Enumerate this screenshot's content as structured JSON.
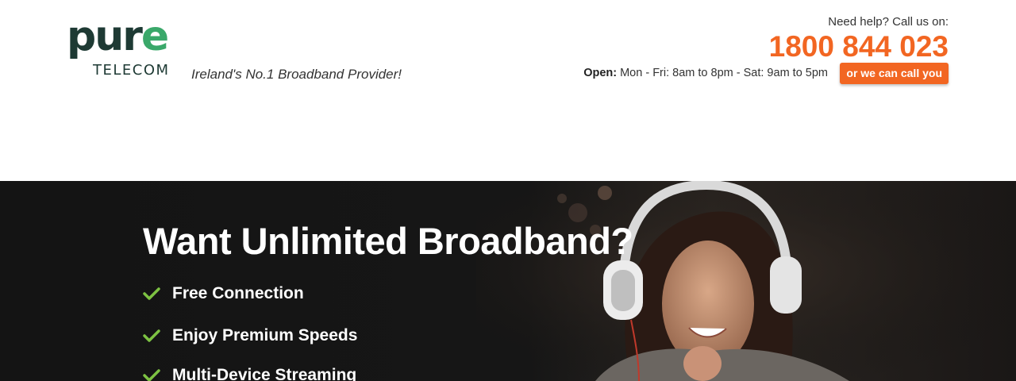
{
  "header": {
    "logo": {
      "brand": "pure",
      "sub": "TELECOM"
    },
    "tagline": "Ireland's No.1 Broadband Provider!",
    "help_text": "Need help? Call us on:",
    "phone": "1800 844 023",
    "hours_label": "Open:",
    "hours_text": " Mon - Fri: 8am to 8pm - Sat: 9am to 5pm",
    "callback_label": "or we can call you"
  },
  "hero": {
    "title": "Want Unlimited Broadband?",
    "features": [
      "Free Connection",
      "Enjoy Premium Speeds",
      "Multi-Device Streaming"
    ]
  },
  "colors": {
    "accent_orange": "#f26622",
    "check_green": "#7dc242",
    "logo_dark": "#1e3a34",
    "hero_bg": "#141414"
  },
  "icons": {
    "feature_bullet": "check-icon"
  }
}
